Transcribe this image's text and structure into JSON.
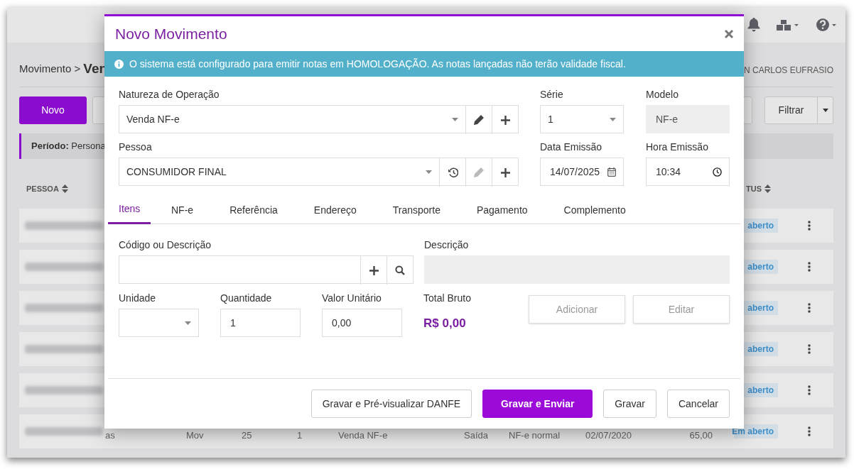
{
  "page": {
    "breadcrumb": "Movimento >",
    "breadcrumb_current": "Ven",
    "user": "N CARLOS EUFRASIO",
    "new_button": "Novo",
    "filter_button": "Filtrar",
    "period": "**Período:** Persona",
    "columns": [
      {
        "label": "PESSOA"
      },
      {
        "label": "TUS"
      }
    ],
    "rows": [
      {
        "cells": [],
        "status": "aberto"
      },
      {
        "cells": [],
        "status": "aberto"
      },
      {
        "cells": [],
        "status": "aberto"
      },
      {
        "cells": [],
        "status": "aberto"
      },
      {
        "cells": [],
        "status": "aberto"
      },
      {
        "cells": [
          "as",
          "Mov",
          "25",
          "1",
          "Venda NF-e",
          "Saída",
          "NF-e normal",
          "02/07/2020",
          "65,00"
        ],
        "status": "Em aberto"
      }
    ]
  },
  "modal": {
    "title": "Novo Movimento",
    "alert": "O sistema está configurado para emitir notas em HOMOLOGAÇÃO. As notas lançadas não terão validade fiscal.",
    "natureza": {
      "label": "Natureza de Operação",
      "value": "Venda NF-e",
      "edit_disabled": false
    },
    "serie": {
      "label": "Série",
      "value": "1"
    },
    "modelo": {
      "label": "Modelo",
      "value": "NF-e",
      "disabled": true
    },
    "pessoa": {
      "label": "Pessoa",
      "value": "CONSUMIDOR FINAL",
      "edit_disabled": true
    },
    "data": {
      "label": "Data Emissão",
      "value": "14/07/2025"
    },
    "hora": {
      "label": "Hora Emissão",
      "value": "10:34"
    },
    "tabs": [
      {
        "label": "Itens",
        "selected": true
      },
      {
        "label": "NF-e",
        "selected": false
      },
      {
        "label": "Referência",
        "selected": false
      },
      {
        "label": "Endereço",
        "selected": false
      },
      {
        "label": "Transporte",
        "selected": false
      },
      {
        "label": "Pagamento",
        "selected": false
      },
      {
        "label": "Complemento",
        "selected": false
      }
    ],
    "codigo": {
      "label": "Código ou Descrição"
    },
    "descricao": {
      "label": "Descrição",
      "disabled": true
    },
    "unidade": {
      "label": "Unidade"
    },
    "quantidade": {
      "label": "Quantidade",
      "value": "1"
    },
    "valor": {
      "label": "Valor Unitário",
      "value": "0,00"
    },
    "total": {
      "label": "Total Bruto",
      "value": "R$ 0,00"
    },
    "item_buttons": [
      {
        "label": "Adicionar",
        "disabled": true
      },
      {
        "label": "Editar",
        "disabled": true
      }
    ],
    "footer_buttons": [
      {
        "label": "Gravar e Pré-visualizar DANFE",
        "kind": "default"
      },
      {
        "label": "Gravar e Enviar",
        "kind": "primary"
      },
      {
        "label": "Gravar",
        "kind": "default"
      },
      {
        "label": "Cancelar",
        "kind": "default"
      }
    ]
  }
}
